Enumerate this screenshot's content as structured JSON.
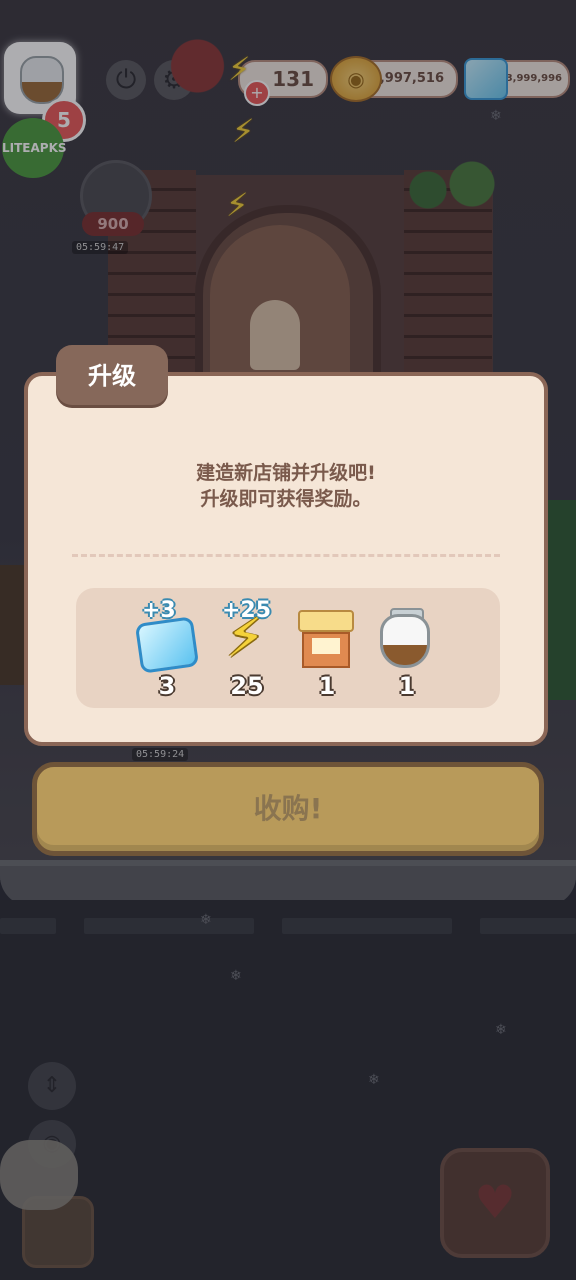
{
  "hud": {
    "jar_count": "5",
    "watermark": "LITEAPKS",
    "energy": "131",
    "coins": "53,997,516",
    "gems": "53,999,996"
  },
  "scene": {
    "timers": [
      "05:59:47",
      "05:59:24"
    ],
    "ghost_badge": "900"
  },
  "modal": {
    "tab_title": "升级",
    "message_line1": "建造新店铺并升级吧!",
    "message_line2": "升级即可获得奖励。",
    "rewards": [
      {
        "icon": "gem-icon",
        "plus": "+3",
        "qty": "3"
      },
      {
        "icon": "lightning-icon",
        "plus": "+25",
        "qty": "25"
      },
      {
        "icon": "shop-icon",
        "plus": "",
        "qty": "1"
      },
      {
        "icon": "jar-icon",
        "plus": "",
        "qty": "1"
      }
    ],
    "buy_label": "收购!"
  },
  "colors": {
    "modal_bg": "#f5e6d7",
    "modal_border": "#8a6656",
    "tab_bg": "#86685a",
    "button_bg": "#b89a5a"
  }
}
